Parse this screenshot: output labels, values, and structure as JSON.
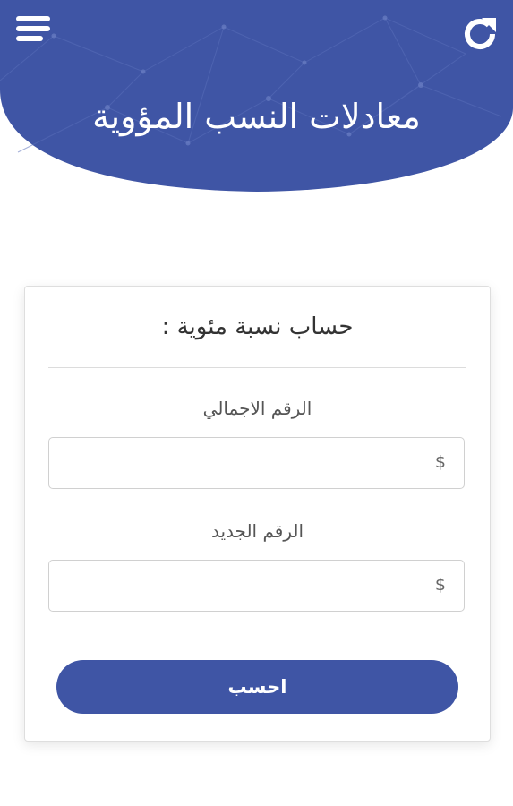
{
  "header": {
    "title": "معادلات النسب المؤوية",
    "menu_icon": "hamburger-menu-icon",
    "refresh_icon": "refresh-icon",
    "color": "#3f55a5"
  },
  "card": {
    "title": "حساب نسبة مئوية :",
    "fields": [
      {
        "label": "الرقم الاجمالي",
        "value": "",
        "currency": "$"
      },
      {
        "label": "الرقم الجديد",
        "value": "",
        "currency": "$"
      }
    ],
    "submit_label": "احسب"
  }
}
